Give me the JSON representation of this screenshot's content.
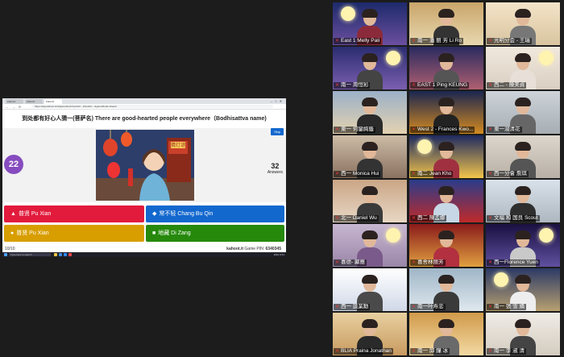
{
  "browser": {
    "tabs": [
      "Kahoot!",
      "Kahoot!",
      "Kahoot!"
    ],
    "url": "https://play.kahoot.it/v2/gameblock?quizId=...&hostId=...&gameMode=classic"
  },
  "kahoot": {
    "question": "到处都有好心人猜一(菩萨名) There are good-hearted people everywhere（Bodhisattva name)",
    "timer": "22",
    "skip_label": "Skip",
    "answers_count": "32",
    "answers_label": "Answers",
    "choices": [
      {
        "symbol": "▲",
        "text": "普贤 Pu Xian",
        "color": "#e21b3c",
        "shape": "triangle"
      },
      {
        "symbol": "◆",
        "text": "常不轻 Chang Bu Qin",
        "color": "#1368ce",
        "shape": "diamond"
      },
      {
        "symbol": "●",
        "text": "普贤 Pu Xian",
        "color": "#d89e00",
        "shape": "circle"
      },
      {
        "symbol": "■",
        "text": "地藏 Di Zang",
        "color": "#26890c",
        "shape": "square"
      }
    ],
    "progress": "10/10",
    "brand": "kahoot.it",
    "game_pin_label": "Game PIN:",
    "game_pin": "6340345",
    "picture_sign": "猜灯谜"
  },
  "taskbar": {
    "search_placeholder": "Type here to search",
    "tray": "ENG 9:41"
  },
  "participants": [
    "East 1 Melly Pali",
    "南一 潘 丽 芳 Li Ro",
    "光明分会 - 王瑞",
    "南一 周恒彩",
    "EAST 1 Ping KEUNG",
    "西二 - 陳美貞",
    "東一 何鑾絢蔭",
    "West 2 - Frances Kwo...",
    "東一湯清花",
    "西一 Monica Hui",
    "南二 Jean Kho",
    "西一分會 詹琪",
    "北一 Daniel Wu",
    "西二 陳孟娜",
    "文福 和 国良 Scout",
    "喜德- 鄺應",
    "喜舍林丽芳",
    "西一Florence Yuen",
    "西一 談業勳",
    "南一叶寿忠",
    "南一 張 雪 嬌",
    "BLIA Praina Jonathan",
    "南一 邱 鐘 冰",
    "南一 李 淑 清"
  ],
  "colors": {
    "accent": "#864cbf",
    "active_speaker": "#2ecc40"
  }
}
